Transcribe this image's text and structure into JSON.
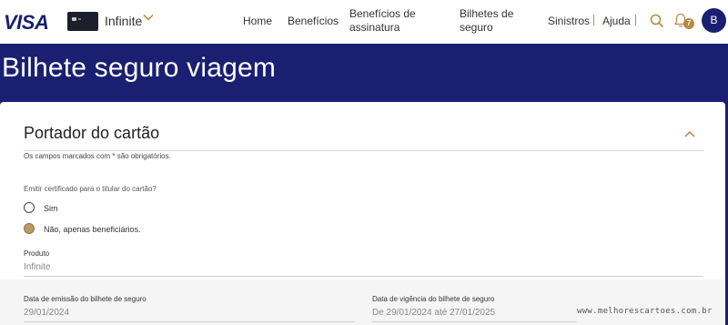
{
  "header": {
    "brand": "VISA",
    "card": {
      "name": "Infinite"
    },
    "nav": [
      {
        "label": "Home"
      },
      {
        "label": "Benefícios"
      },
      {
        "label_line1": "Benefícios de",
        "label_line2": "assinatura"
      },
      {
        "label_line1": "Bilhetes de",
        "label_line2": "seguro"
      },
      {
        "label": "Sinistros"
      },
      {
        "label": "Ajuda"
      }
    ],
    "notifications_count": "7",
    "avatar_initial": "B",
    "colors": {
      "navy": "#1a1f71",
      "gold": "#b78b3f"
    }
  },
  "page": {
    "title": "Bilhete seguro viagem"
  },
  "section": {
    "title": "Portador do cartão",
    "required_note": "Os campos marcados com * são obrigatórios.",
    "question": "Emitir certificado para o titular do cartão?",
    "options": [
      {
        "label": "Sim",
        "checked": false
      },
      {
        "label": "Não, apenas beneficiários.",
        "checked": true
      }
    ],
    "produto": {
      "label": "Produto",
      "value": "Infinite"
    },
    "emissao": {
      "label": "Data de emissão do bilhete de seguro",
      "value": "29/01/2024"
    },
    "vigencia": {
      "label": "Data de vigência do bilhete de seguro",
      "value": "De 29/01/2024 até 27/01/2025"
    }
  },
  "watermark": "www.melhorescartoes.com.br"
}
